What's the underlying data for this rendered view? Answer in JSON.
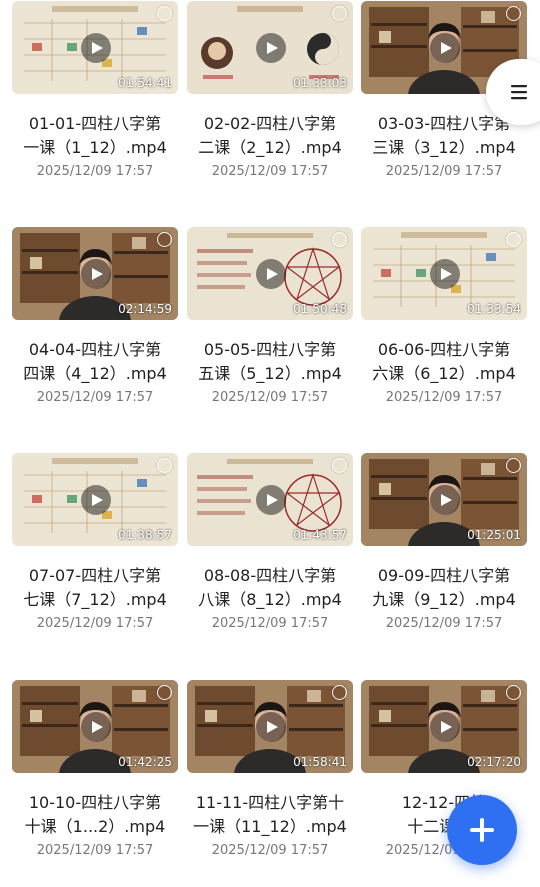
{
  "videos": [
    {
      "title": "01-01-四柱八字第一课（1_12）.mp4",
      "line1": "01-01-四柱八字第",
      "line2": "一课（1_12）.mp4",
      "date": "2025/12/09 17:57",
      "duration": "01:54:41",
      "thumb": "slide-table"
    },
    {
      "title": "02-02-四柱八字第二课（2_12）.mp4",
      "line1": "02-02-四柱八字第",
      "line2": "二课（2_12）.mp4",
      "date": "2025/12/09 17:57",
      "duration": "01:33:03",
      "thumb": "slide-taiji"
    },
    {
      "title": "03-03-四柱八字第三课（3_12）.mp4",
      "line1": "03-03-四柱八字第",
      "line2": "三课（3_12）.mp4",
      "date": "2025/12/09 17:57",
      "duration": "01:",
      "thumb": "presenter"
    },
    {
      "title": "04-04-四柱八字第四课（4_12）.mp4",
      "line1": "04-04-四柱八字第",
      "line2": "四课（4_12）.mp4",
      "date": "2025/12/09 17:57",
      "duration": "02:14:59",
      "thumb": "presenter"
    },
    {
      "title": "05-05-四柱八字第五课（5_12）.mp4",
      "line1": "05-05-四柱八字第",
      "line2": "五课（5_12）.mp4",
      "date": "2025/12/09 17:57",
      "duration": "01:50:48",
      "thumb": "slide-star"
    },
    {
      "title": "06-06-四柱八字第六课（6_12）.mp4",
      "line1": "06-06-四柱八字第",
      "line2": "六课（6_12）.mp4",
      "date": "2025/12/09 17:57",
      "duration": "01:33:54",
      "thumb": "slide-table"
    },
    {
      "title": "07-07-四柱八字第七课（7_12）.mp4",
      "line1": "07-07-四柱八字第",
      "line2": "七课（7_12）.mp4",
      "date": "2025/12/09 17:57",
      "duration": "01:38:57",
      "thumb": "slide-table"
    },
    {
      "title": "08-08-四柱八字第八课（8_12）.mp4",
      "line1": "08-08-四柱八字第",
      "line2": "八课（8_12）.mp4",
      "date": "2025/12/09 17:57",
      "duration": "01:43:57",
      "thumb": "slide-star"
    },
    {
      "title": "09-09-四柱八字第九课（9_12）.mp4",
      "line1": "09-09-四柱八字第",
      "line2": "九课（9_12）.mp4",
      "date": "2025/12/09 17:57",
      "duration": "01:25:01",
      "thumb": "presenter"
    },
    {
      "title": "10-10-四柱八字第十课（1...2）.mp4",
      "line1": "10-10-四柱八字第",
      "line2": "十课（1...2）.mp4",
      "date": "2025/12/09 17:57",
      "duration": "01:42:25",
      "thumb": "presenter"
    },
    {
      "title": "11-11-四柱八字第十一课（11_12）.mp4",
      "line1": "11-11-四柱八字第十",
      "line2": "一课（11_12）.mp4",
      "date": "2025/12/09 17:57",
      "duration": "01:58:41",
      "thumb": "presenter"
    },
    {
      "title": "12-12-四柱八字第十二课...2）.mp4",
      "line1": "12-12-四柱",
      "line2": "十二课...2",
      "date": "2025/12/09 17:57",
      "duration": "02:17:20",
      "thumb": "presenter"
    }
  ],
  "colors": {
    "accent": "#2f6ff2",
    "title_text": "#222222",
    "date_text": "#777777"
  },
  "icons": {
    "menu": "hamburger-menu-icon",
    "add": "plus-icon",
    "play": "play-icon",
    "select": "select-circle-icon"
  }
}
